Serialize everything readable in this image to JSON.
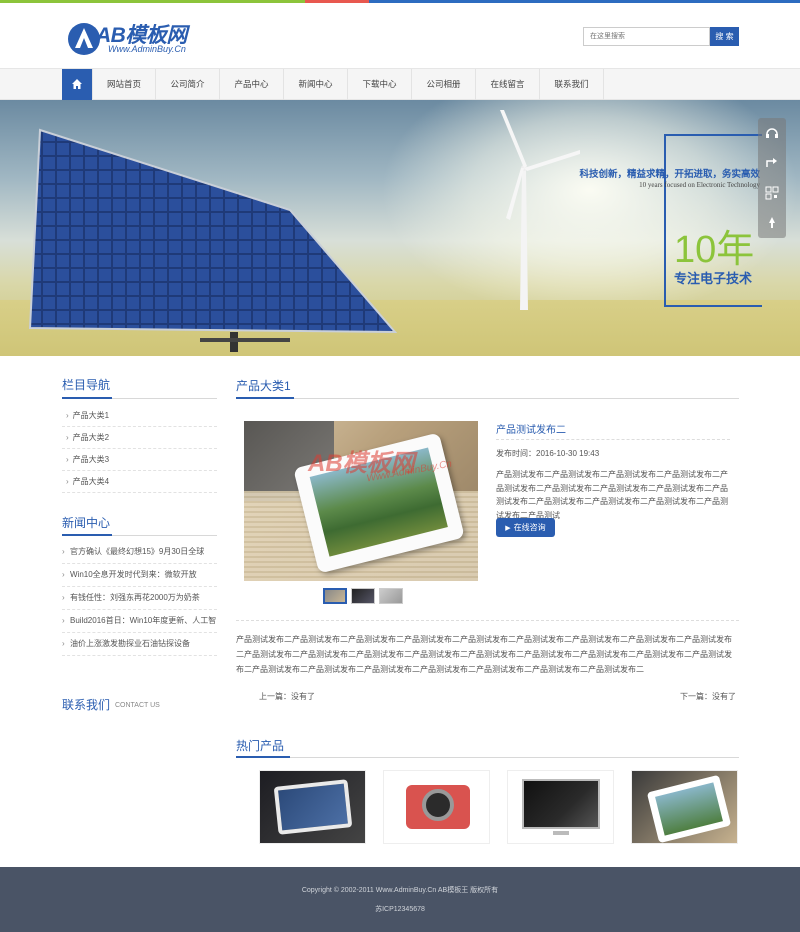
{
  "header": {
    "logo_text": "AB模板网",
    "logo_url": "Www.AdminBuy.Cn",
    "search_placeholder": "在这里搜索",
    "search_button": "搜 索"
  },
  "nav": {
    "items": [
      "网站首页",
      "公司简介",
      "产品中心",
      "新闻中心",
      "下载中心",
      "公司相册",
      "在线留言",
      "联系我们"
    ]
  },
  "banner": {
    "slogan": "科技创新，精益求精，开拓进取，务实高效",
    "slogan_en": "10 years focused on Electronic Technology",
    "years": "10年",
    "focus": "专注电子技术"
  },
  "sidebar": {
    "nav_title": "栏目导航",
    "categories": [
      "产品大类1",
      "产品大类2",
      "产品大类3",
      "产品大类4"
    ],
    "news_title": "新闻中心",
    "news": [
      "官方确认《最终幻想15》9月30日全球",
      "Win10全息开发时代到来：微软开放",
      "有钱任性：刘强东再花2000万为奶茶",
      "Build2016首日：Win10年度更新、人工智",
      "油价上涨激发勘探业石油钻探设备"
    ],
    "contact_title": "联系我们",
    "contact_en": "CONTACT US"
  },
  "main": {
    "section_title": "产品大类1",
    "product": {
      "title": "产品测试发布二",
      "time": "发布时间：2016-10-30 19:43",
      "desc": "产品测试发布二产品测试发布二产品测试发布二产品测试发布二产品测试发布二产品测试发布二产品测试发布二产品测试发布二产品测试发布二产品测试发布二产品测试发布二产品测试发布二产品测试发布二产品测试",
      "consult_button": "在线咨询",
      "watermark": "AB模板网",
      "watermark_url": "Www.AdminBuy.Cn"
    },
    "content": "产品测试发布二产品测试发布二产品测试发布二产品测试发布二产品测试发布二产品测试发布二产品测试发布二产品测试发布二产品测试发布二产品测试发布二产品测试发布二产品测试发布二产品测试发布二产品测试发布二产品测试发布二产品测试发布二产品测试发布二产品测试发布二产品测试发布二产品测试发布二产品测试发布二产品测试发布二产品测试发布二产品测试发布二产品测试发布二",
    "prev": "上一篇：没有了",
    "next": "下一篇：没有了",
    "hot_title": "热门产品"
  },
  "footer": {
    "copyright": "Copyright © 2002-2011 Www.AdminBuy.Cn AB模板王 版权所有",
    "icp": "苏ICP12345678"
  },
  "colors": {
    "brand_blue": "#2a5db0",
    "accent_green": "#8cc43b",
    "accent_red": "#e8584f",
    "footer_bg": "#4a5466"
  }
}
